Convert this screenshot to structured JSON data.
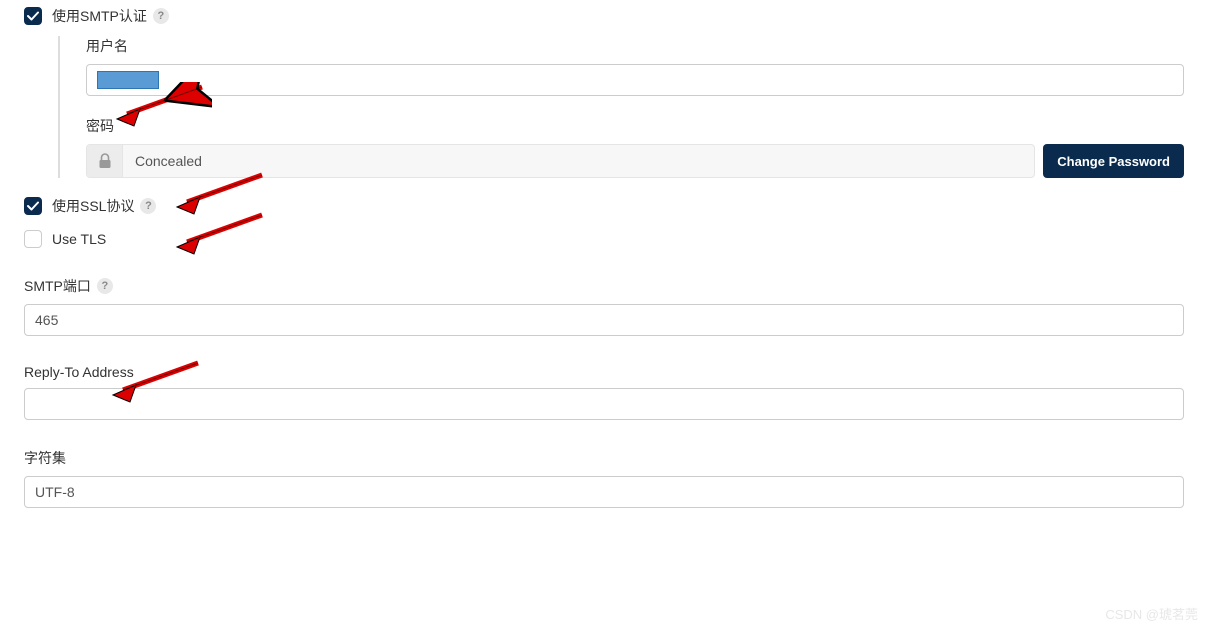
{
  "smtp_auth": {
    "label": "使用SMTP认证",
    "checked": true,
    "username_label": "用户名",
    "username_value": "",
    "password_label": "密码",
    "password_display": "Concealed",
    "change_password_btn": "Change Password"
  },
  "ssl": {
    "label": "使用SSL协议",
    "checked": true
  },
  "tls": {
    "label": "Use TLS",
    "checked": false
  },
  "smtp_port": {
    "label": "SMTP端口",
    "value": "465"
  },
  "reply_to": {
    "label": "Reply-To Address",
    "value": ""
  },
  "charset": {
    "label": "字符集",
    "value": "UTF-8"
  },
  "watermark": "CSDN @琥茗莞"
}
